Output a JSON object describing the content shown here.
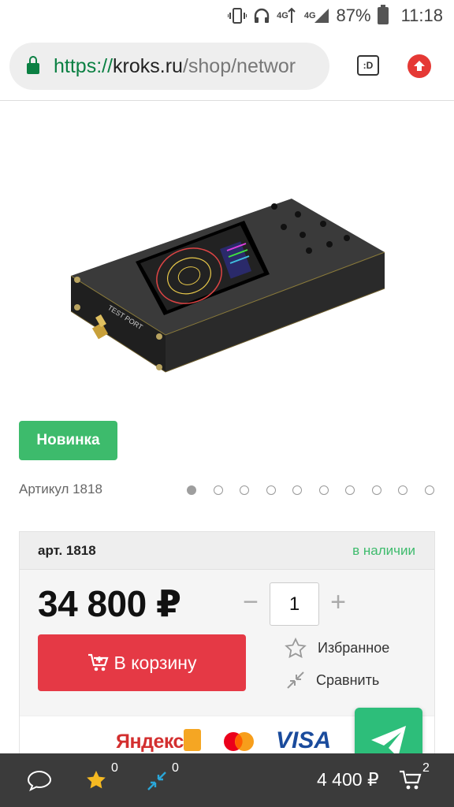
{
  "status_bar": {
    "network_1": "4G",
    "network_2": "4G",
    "battery": "87%",
    "time": "11:18"
  },
  "browser": {
    "url_scheme": "https://",
    "url_host": "kroks.ru",
    "url_path": "/shop/networ",
    "tab_switcher_label": ":D",
    "icons": [
      "lock-icon",
      "tab-switcher-icon",
      "update-icon"
    ]
  },
  "product": {
    "badge": "Новинка",
    "article_label": "Артикул 1818",
    "carousel": {
      "total": 10,
      "active": 1
    },
    "image_texts": {
      "port_label": "TEST PORT"
    }
  },
  "buy_box": {
    "art_code": "арт. 1818",
    "availability": "в наличии",
    "price": "34 800 ₽",
    "quantity": "1",
    "minus": "−",
    "plus": "+",
    "cart_button": "В корзину",
    "favorite": "Избранное",
    "compare": "Сравнить",
    "payment": {
      "yandex": "Яндекс",
      "visa": "VISA"
    }
  },
  "bottom_bar": {
    "favorites_count": "0",
    "compare_count": "0",
    "cart_total": "4 400 ₽",
    "cart_count": "2"
  },
  "colors": {
    "accent_green": "#3dbb6c",
    "cart_red": "#e53945",
    "bottom_bar": "#3b3b3b",
    "fab_green": "#2dbe7a"
  }
}
